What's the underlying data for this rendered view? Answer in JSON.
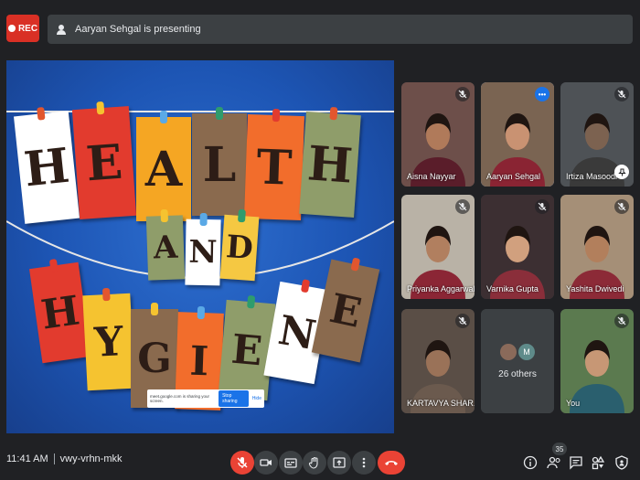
{
  "recording": {
    "label": "REC"
  },
  "presenting_banner": {
    "text": "Aaryan Sehgal is presenting"
  },
  "slide": {
    "word1": [
      "H",
      "E",
      "A",
      "L",
      "T",
      "H"
    ],
    "word2": [
      "A",
      "N",
      "D"
    ],
    "word3": [
      "H",
      "Y",
      "G",
      "I",
      "E",
      "N",
      "E"
    ],
    "card_colors1": [
      "#ffffff",
      "#e23b2e",
      "#f5a623",
      "#8a6a4e",
      "#f26d2c",
      "#8f9d6a"
    ],
    "card_colors2": [
      "#8f9d6a",
      "#ffffff",
      "#f5c842"
    ],
    "card_colors3": [
      "#e23b2e",
      "#f5c330",
      "#8a6a4e",
      "#f26d2c",
      "#8f9d6a",
      "#ffffff",
      "#8a6a4e"
    ],
    "pin_colors": [
      "#e2562e",
      "#f5c330",
      "#5aa9e6",
      "#2e9c6d",
      "#e23b2e"
    ]
  },
  "share_banner": {
    "text": "meet.google.com is sharing your screen.",
    "stop_label": "Stop sharing",
    "hide_label": "Hide"
  },
  "participants": [
    {
      "name": "Aisna Nayyar",
      "bg": "#6d4f4a",
      "skin": "#b07a5a",
      "cloth": "#5a1d2a",
      "muted": true
    },
    {
      "name": "Aaryan Sehgal",
      "bg": "#7a6452",
      "skin": "#c99272",
      "cloth": "#8a2433",
      "active": true
    },
    {
      "name": "Irtiza Masoodi",
      "bg": "#4e5256",
      "skin": "#7c6250",
      "cloth": "#3a3a3a",
      "muted": true
    },
    {
      "name": "Priyanka Aggarwal",
      "bg": "#b9b2a6",
      "skin": "#b17f5f",
      "cloth": "#8b2635",
      "muted": true
    },
    {
      "name": "Varnika Gupta",
      "bg": "#3c2f32",
      "skin": "#d1a07e",
      "cloth": "#8a2e3a",
      "muted": true
    },
    {
      "name": "Yashita Dwivedi",
      "bg": "#a58f77",
      "skin": "#b27f5c",
      "cloth": "#8c2a37",
      "muted": true
    },
    {
      "name": "KARTAVYA SHAR...",
      "bg": "#5a4e46",
      "skin": "#9a7258",
      "cloth": "#6b5a4e",
      "muted": true
    },
    {
      "name": "You",
      "bg": "#5b7a4f",
      "skin": "#c79775",
      "cloth": "#2a5f6e",
      "muted": true
    }
  ],
  "others_tile": {
    "label": "26 others",
    "avatar_letter": "M",
    "avatar_color": "#5f8b8a"
  },
  "bottombar": {
    "time": "11:41 AM",
    "meeting_code": "vwy-vrhn-mkk",
    "people_count": "35"
  },
  "colors": {
    "bg": "#202124",
    "tile": "#3c4043",
    "danger": "#ea4335",
    "accent": "#8ab4f8"
  }
}
